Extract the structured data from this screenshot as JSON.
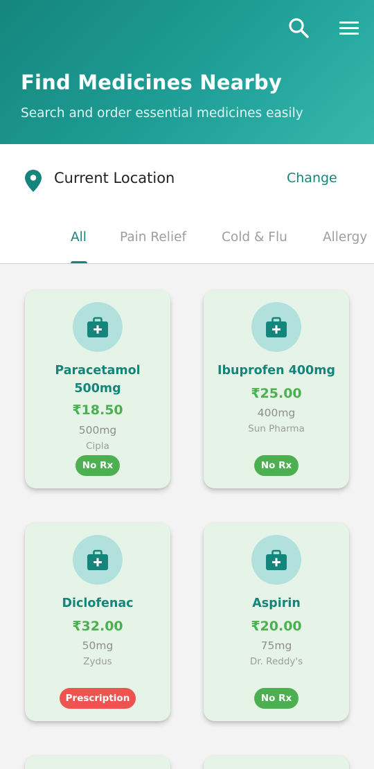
{
  "header": {
    "title": "Find Medicines Nearby",
    "subtitle": "Search and order essential medicines easily",
    "search_icon": "search-icon",
    "menu_icon": "menu-icon"
  },
  "location": {
    "icon": "location-pin-icon",
    "label": "Current Location",
    "change_label": "Change"
  },
  "tabs": [
    {
      "label": "All",
      "active": true
    },
    {
      "label": "Pain Relief",
      "active": false
    },
    {
      "label": "Cold & Flu",
      "active": false
    },
    {
      "label": "Allergy",
      "active": false
    }
  ],
  "medicines": [
    {
      "name_line1": "Paracetamol",
      "name_line2": "500mg",
      "price": "₹18.50",
      "dose": "500mg",
      "maker": "Cipla",
      "badge": "No Rx"
    },
    {
      "name_line1": "Ibuprofen 400mg",
      "name_line2": "",
      "price": "₹25.00",
      "dose": "400mg",
      "maker": "Sun Pharma",
      "badge": "No Rx"
    },
    {
      "name_line1": "Diclofenac",
      "name_line2": "",
      "price": "₹32.00",
      "dose": "50mg",
      "maker": "Zydus",
      "badge": "Prescription"
    },
    {
      "name_line1": "Aspirin",
      "name_line2": "",
      "price": "₹20.00",
      "dose": "75mg",
      "maker": "Dr. Reddy's",
      "badge": "No Rx"
    }
  ],
  "colors": {
    "primary": "#15857c",
    "price_green": "#4caf50",
    "prescription_red": "#ef5350",
    "card_bg": "#e6f4e8"
  }
}
